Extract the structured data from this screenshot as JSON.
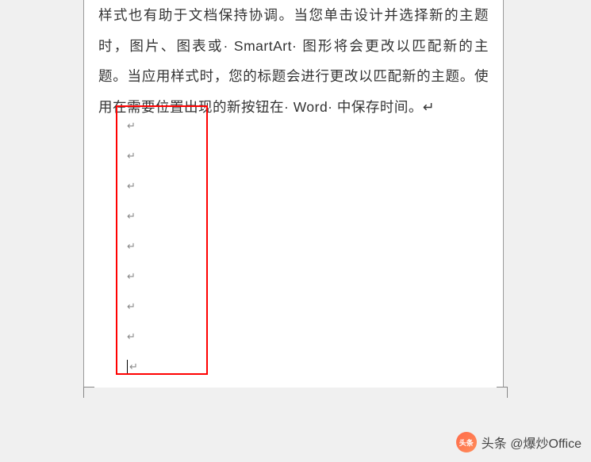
{
  "document": {
    "paragraphs": [
      "样式也有助于文档保持协调。当您单击设计并选择新的主题时，图片、图表或· SmartArt· 图形将会更改以匹配新的主题。当应用样式时，您的标题会进行更改以匹配新的主题。使用在需要位置出现的新按钮在· Word· 中保存时间。↵"
    ],
    "emptyLineCount": 9,
    "paragraphMark": "↵"
  },
  "watermark": {
    "avatarText": "头条",
    "prefix": "头条",
    "handle": "@爆炒Office"
  }
}
